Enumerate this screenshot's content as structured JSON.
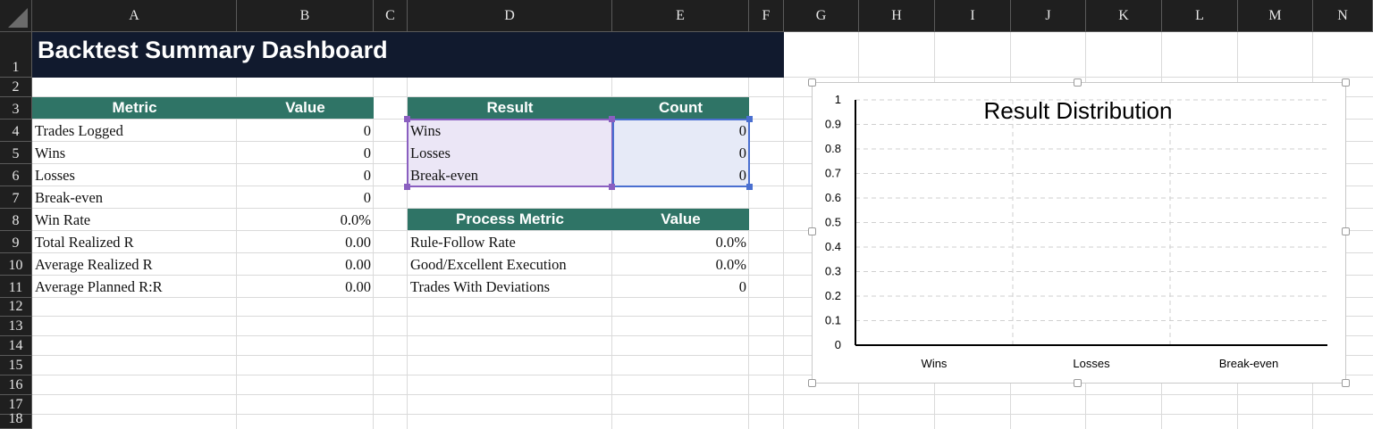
{
  "columns": [
    "A",
    "B",
    "C",
    "D",
    "E",
    "F",
    "G",
    "H",
    "I",
    "J",
    "K",
    "L",
    "M",
    "N"
  ],
  "rows": [
    "1",
    "2",
    "3",
    "4",
    "5",
    "6",
    "7",
    "8",
    "9",
    "10",
    "11",
    "12",
    "13",
    "14",
    "15",
    "16",
    "17",
    "18"
  ],
  "title": "Backtest Summary Dashboard",
  "summary_table": {
    "header_metric": "Metric",
    "header_value": "Value",
    "rows": [
      {
        "label": "Trades Logged",
        "value": "0"
      },
      {
        "label": "Wins",
        "value": "0"
      },
      {
        "label": "Losses",
        "value": "0"
      },
      {
        "label": "Break-even",
        "value": "0"
      },
      {
        "label": "Win Rate",
        "value": "0.0%"
      },
      {
        "label": "Total Realized R",
        "value": "0.00"
      },
      {
        "label": "Average Realized R",
        "value": "0.00"
      },
      {
        "label": "Average Planned R:R",
        "value": "0.00"
      }
    ]
  },
  "result_table": {
    "header_result": "Result",
    "header_count": "Count",
    "rows": [
      {
        "label": "Wins",
        "value": "0"
      },
      {
        "label": "Losses",
        "value": "0"
      },
      {
        "label": "Break-even",
        "value": "0"
      }
    ]
  },
  "process_table": {
    "header_metric": "Process Metric",
    "header_value": "Value",
    "rows": [
      {
        "label": "Rule-Follow Rate",
        "value": "0.0%"
      },
      {
        "label": "Good/Excellent Execution",
        "value": "0.0%"
      },
      {
        "label": "Trades With Deviations",
        "value": "0"
      }
    ]
  },
  "colors": {
    "header_fill": "#2f7466",
    "title_fill": "#111a2e",
    "selection_purple": "#8a5fc0",
    "selection_blue": "#4a6fd0"
  },
  "chart_data": {
    "type": "bar",
    "title": "Result Distribution",
    "categories": [
      "Wins",
      "Losses",
      "Break-even"
    ],
    "values": [
      0,
      0,
      0
    ],
    "ylim": [
      0,
      1
    ],
    "yticks": [
      "0",
      "0.1",
      "0.2",
      "0.3",
      "0.4",
      "0.5",
      "0.6",
      "0.7",
      "0.8",
      "0.9",
      "1"
    ],
    "grid": true,
    "xlabel": "",
    "ylabel": ""
  }
}
